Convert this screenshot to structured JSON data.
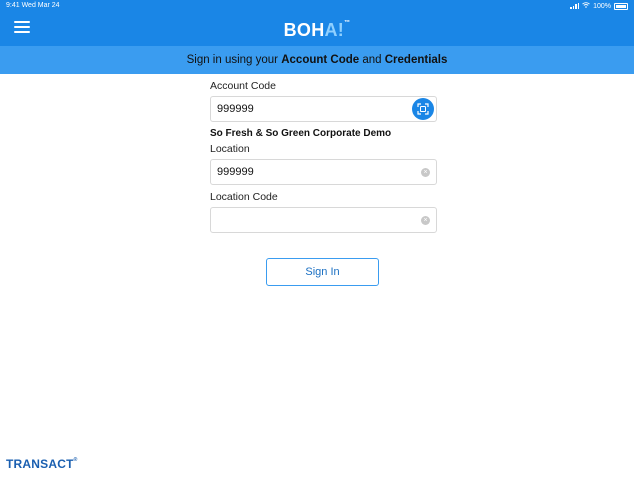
{
  "status": {
    "time": "9:41 Wed Mar 24",
    "battery": "100%"
  },
  "app": {
    "logo_main": "BOH",
    "logo_accent": "A!",
    "logo_tm": "™"
  },
  "banner": {
    "prefix": "Sign in using your ",
    "bold1": "Account Code",
    "middle": " and ",
    "bold2": "Credentials"
  },
  "form": {
    "account_code_label": "Account Code",
    "account_code_value": "999999",
    "company_name": "So Fresh & So Green Corporate Demo",
    "location_label": "Location",
    "location_value": "999999",
    "location_code_label": "Location Code",
    "location_code_value": "",
    "clear_glyph": "×"
  },
  "actions": {
    "sign_in_label": "Sign In"
  },
  "footer": {
    "brand": "TRANSACT",
    "brand_mark": "®"
  },
  "colors": {
    "primary": "#1a86e6",
    "banner": "#3a9cf0",
    "brand": "#1a5fb0"
  }
}
